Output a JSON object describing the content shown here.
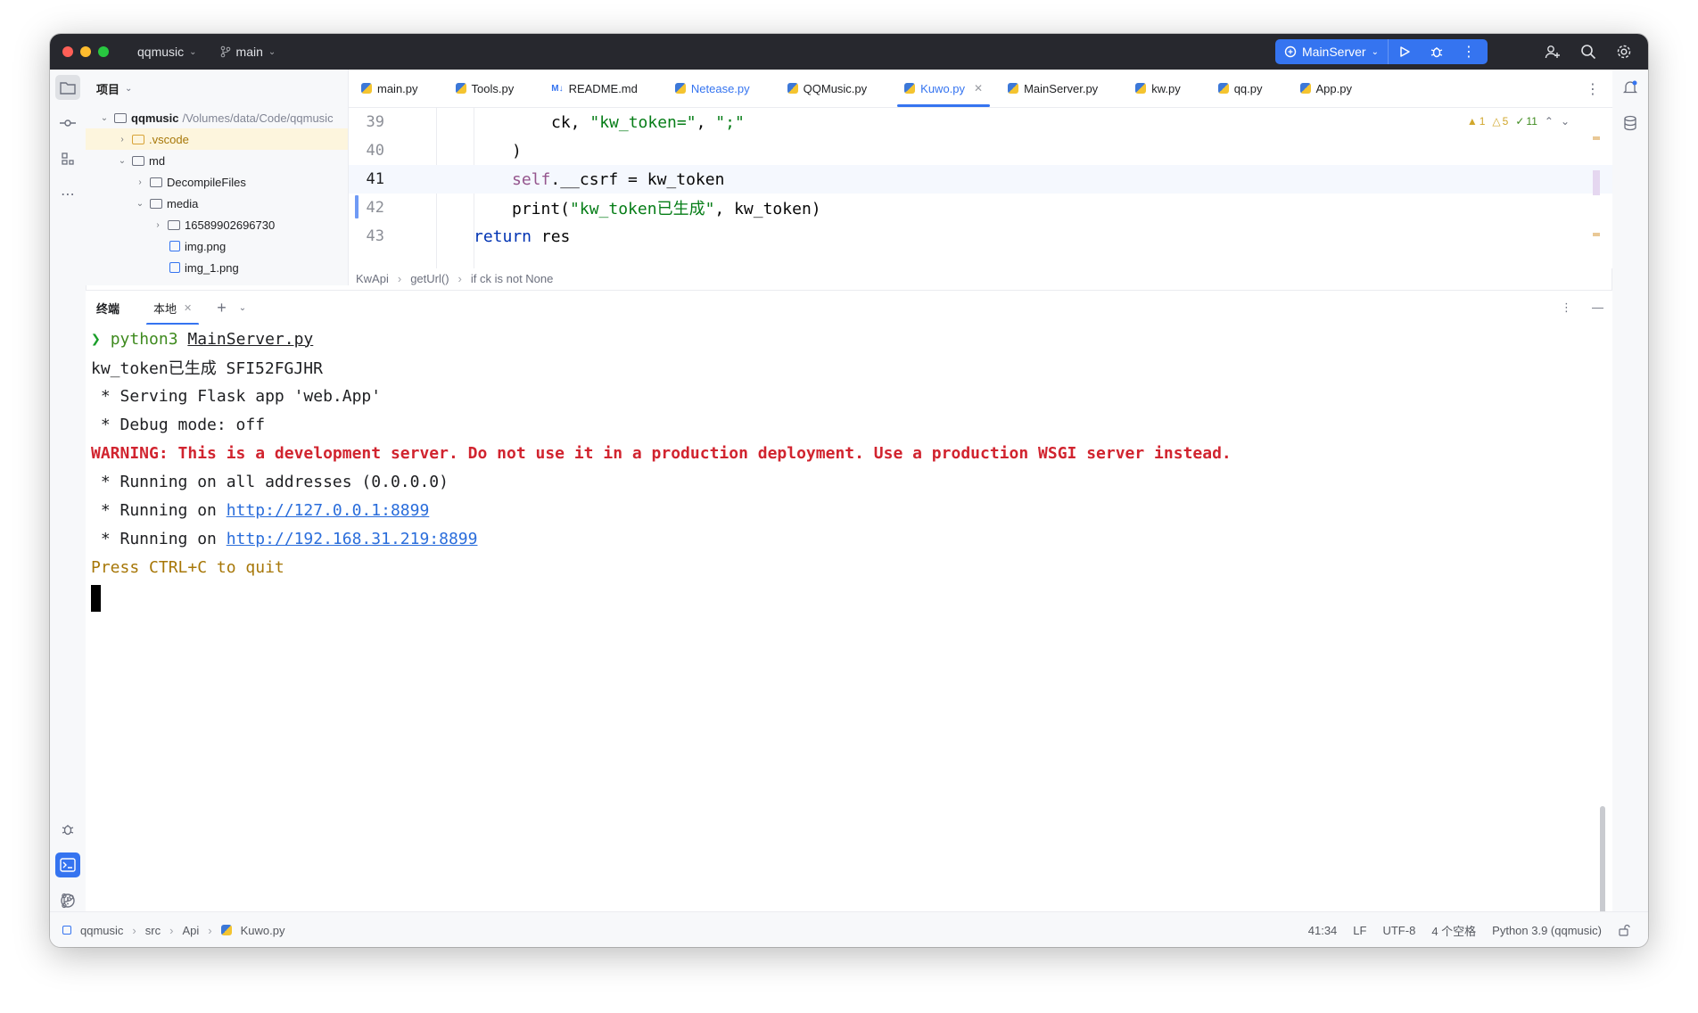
{
  "titlebar": {
    "project": "qqmusic",
    "branch": "main",
    "run_config": "MainServer"
  },
  "project_panel": {
    "title": "项目",
    "tree": [
      {
        "label": "qqmusic",
        "path": "/Volumes/data/Code/qqmusic",
        "level": 0,
        "expanded": true,
        "kind": "folder"
      },
      {
        "label": ".vscode",
        "level": 1,
        "expanded": false,
        "kind": "folder-yellow",
        "selected": true
      },
      {
        "label": "md",
        "level": 1,
        "expanded": true,
        "kind": "folder"
      },
      {
        "label": "DecompileFiles",
        "level": 2,
        "expanded": false,
        "kind": "folder"
      },
      {
        "label": "media",
        "level": 2,
        "expanded": true,
        "kind": "folder"
      },
      {
        "label": "16589902696730",
        "level": 3,
        "expanded": false,
        "kind": "folder"
      },
      {
        "label": "img.png",
        "level": 3,
        "kind": "image"
      },
      {
        "label": "img_1.png",
        "level": 3,
        "kind": "image"
      }
    ]
  },
  "editor_tabs": [
    {
      "label": "main.py",
      "icon": "python-icon"
    },
    {
      "label": "Tools.py",
      "icon": "python-icon"
    },
    {
      "label": "README.md",
      "icon": "markdown-icon"
    },
    {
      "label": "Netease.py",
      "icon": "python-icon",
      "modified": true
    },
    {
      "label": "QQMusic.py",
      "icon": "python-icon"
    },
    {
      "label": "Kuwo.py",
      "icon": "python-icon",
      "active": true
    },
    {
      "label": "MainServer.py",
      "icon": "python-icon"
    },
    {
      "label": "kw.py",
      "icon": "python-icon"
    },
    {
      "label": "qq.py",
      "icon": "python-icon"
    },
    {
      "label": "App.py",
      "icon": "python-icon"
    }
  ],
  "inspections": {
    "warnings_strong": "1",
    "warnings_weak": "5",
    "typos": "11"
  },
  "code": {
    "lines": [
      {
        "no": "39"
      },
      {
        "no": "40"
      },
      {
        "no": "41"
      },
      {
        "no": "42"
      },
      {
        "no": "43"
      }
    ],
    "l39": {
      "a": "ck, ",
      "b": "\"kw_token=\"",
      "c": ", ",
      "d": "\";\""
    },
    "l40": {
      "a": ")"
    },
    "l41": {
      "a": "self",
      "b": ".__csrf = kw_token"
    },
    "l42": {
      "a": "print(",
      "b": "\"kw_token已生成\"",
      "c": ", kw_token)"
    },
    "l43": {
      "a": "return",
      "b": " res"
    }
  },
  "breadcrumb": [
    "KwApi",
    "getUrl()",
    "if ck is not None"
  ],
  "terminal": {
    "title": "终端",
    "tab": "本地",
    "lines": {
      "cmd_prefix": "python3 ",
      "cmd_file": "MainServer.py",
      "l1": "kw_token已生成 SFI52FGJHR",
      "l2": " * Serving Flask app 'web.App'",
      "l3": " * Debug mode: off",
      "l4": "WARNING: This is a development server. Do not use it in a production deployment. Use a production WSGI server instead.",
      "l5": " * Running on all addresses (0.0.0.0)",
      "l6_prefix": " * Running on ",
      "l6_link": "http://127.0.0.1:8899",
      "l7_prefix": " * Running on ",
      "l7_link": "http://192.168.31.219:8899",
      "l8": "Press CTRL+C to quit"
    }
  },
  "statusbar": {
    "crumbs": [
      "qqmusic",
      "src",
      "Api",
      "Kuwo.py"
    ],
    "position": "41:34",
    "line_sep": "LF",
    "encoding": "UTF-8",
    "indent": "4 个空格",
    "interpreter": "Python 3.9 (qqmusic)"
  },
  "colors": {
    "accent": "#3574f0",
    "titlebar": "#27282e",
    "warning": "#d1242f"
  }
}
